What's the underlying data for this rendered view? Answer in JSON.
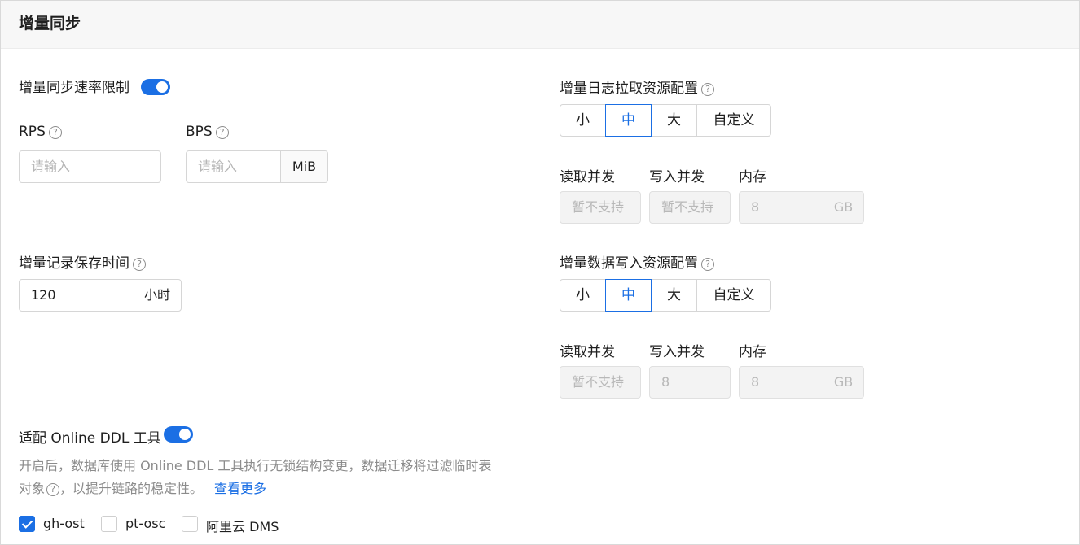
{
  "section": {
    "title": "增量同步"
  },
  "rate_limit": {
    "label": "增量同步速率限制",
    "rps_label": "RPS",
    "bps_label": "BPS",
    "rps_placeholder": "请输入",
    "bps_placeholder": "请输入",
    "bps_unit": "MiB"
  },
  "retention": {
    "label": "增量记录保存时间",
    "value": "120",
    "unit": "小时"
  },
  "log_pull": {
    "label": "增量日志拉取资源配置",
    "options": [
      "小",
      "中",
      "大",
      "自定义"
    ],
    "selected": "中",
    "read_label": "读取并发",
    "write_label": "写入并发",
    "mem_label": "内存",
    "read_value": "暂不支持",
    "write_value": "暂不支持",
    "mem_value": "8",
    "mem_unit": "GB"
  },
  "data_write": {
    "label": "增量数据写入资源配置",
    "options": [
      "小",
      "中",
      "大",
      "自定义"
    ],
    "selected": "中",
    "read_label": "读取并发",
    "write_label": "写入并发",
    "mem_label": "内存",
    "read_value": "暂不支持",
    "write_value": "8",
    "mem_value": "8",
    "mem_unit": "GB"
  },
  "ddl": {
    "label": "适配 Online DDL 工具",
    "desc_line1": "开启后，数据库使用 Online DDL 工具执行无锁结构变更，数据迁移将过滤临时表",
    "desc_line2": "对象",
    "desc_line2_rest": "，以提升链路的稳定性。",
    "link": "查看更多",
    "tools": [
      {
        "label": "gh-ost",
        "checked": true
      },
      {
        "label": "pt-osc",
        "checked": false
      },
      {
        "label": "阿里云 DMS",
        "checked": false
      }
    ]
  },
  "colors": {
    "accent": "#1b6fe4"
  }
}
